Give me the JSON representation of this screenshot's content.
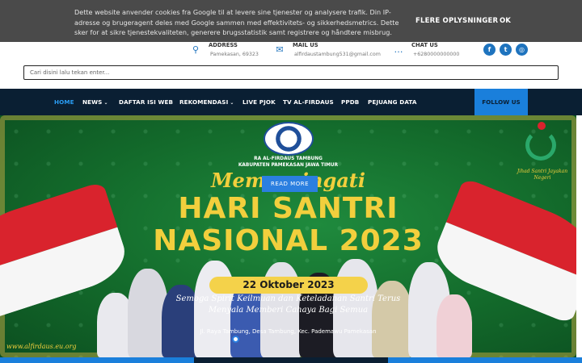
{
  "cookie": {
    "text": "Dette website anvender cookies fra Google til at levere sine tjenester og analysere trafik. Din IP-adresse og brugeragent deles med Google sammen med effektivitets- og sikkerhedsmetrics. Dette sker for at sikre tjenestekvaliteten, generere brugsstatistik samt registrere og håndtere misbrug.",
    "more_label": "FLERE OPLYSNINGER",
    "ok_label": "OK"
  },
  "contact": {
    "address": {
      "label": "ADDRESS",
      "value": "Pamekasan, 69323",
      "icon": "map-pin-icon"
    },
    "mail": {
      "label": "MAIL US",
      "value": "alfirdaustambung531@gmail.com",
      "icon": "envelope-icon"
    },
    "chat": {
      "label": "CHAT US",
      "value": "+6280000000000",
      "icon": "chat-icon"
    }
  },
  "social": [
    {
      "name": "facebook-icon",
      "glyph": "f"
    },
    {
      "name": "twitter-icon",
      "glyph": "t"
    },
    {
      "name": "instagram-icon",
      "glyph": "◎"
    }
  ],
  "search": {
    "placeholder": "Cari disini lalu tekan enter..."
  },
  "nav": {
    "items": [
      {
        "label": "HOME",
        "active": true
      },
      {
        "label": "NEWS",
        "dropdown": true
      },
      {
        "label": "DAFTAR ISI WEB"
      },
      {
        "label": "REKOMENDASI",
        "dropdown": true
      },
      {
        "label": "LIVE PJOK"
      },
      {
        "label": "TV AL-FIRDAUS"
      },
      {
        "label": "PPDB"
      },
      {
        "label": "PEJUANG DATA"
      }
    ],
    "follow_label": "FOLLOW US"
  },
  "hero": {
    "seal_line1": "RA AL-FIRDAUS TAMBUNG",
    "seal_line2": "KABUPATEN PAMEKASAN JAWA TIMUR",
    "script": "Memperingati",
    "title1": "HARI SANTRI",
    "title2": "NASIONAL 2023",
    "date": "22 Oktober 2023",
    "tagline1": "Semoga Spirit Keilmuan dan Keteladanan Santri Terus",
    "tagline2": "Menyala Memberi Cahaya Bagi Semua",
    "address": "Jl. Raya Tambung, Desa Tambung, Kec. Pademawu Pamekasan",
    "website": "www.alfirdaus.eu.org",
    "logo_caption": "Jihad Santri Jayakan Negeri",
    "read_more": "READ MORE"
  },
  "colors": {
    "accent": "#1a7fdb",
    "nav_bg": "#0a1f33",
    "hero_green": "#1f8a3d",
    "gold": "#f2cf3d"
  }
}
